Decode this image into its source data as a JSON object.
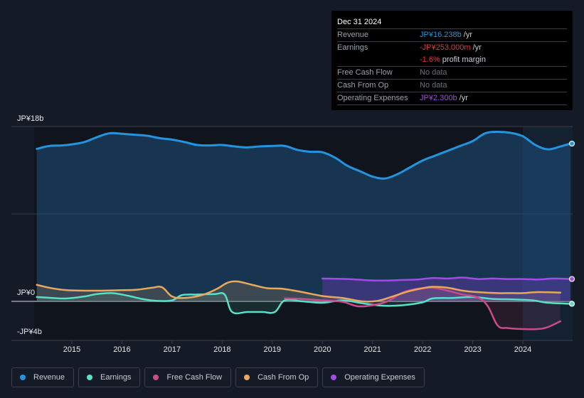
{
  "tooltip": {
    "date": "Dec 31 2024",
    "rows": [
      {
        "label": "Revenue",
        "value": "JP¥16.238b",
        "suffix": " /yr",
        "color": "#2394df"
      },
      {
        "label": "Earnings",
        "value": "-JP¥253.000m",
        "suffix": " /yr",
        "color": "#e5393c"
      },
      {
        "label": "",
        "value": "-1.6%",
        "suffix": " profit margin",
        "color": "#e5393c"
      },
      {
        "label": "Free Cash Flow",
        "value": "No data",
        "suffix": "",
        "color": "#6b7079"
      },
      {
        "label": "Cash From Op",
        "value": "No data",
        "suffix": "",
        "color": "#6b7079"
      },
      {
        "label": "Operating Expenses",
        "value": "JP¥2.300b",
        "suffix": " /yr",
        "color": "#a04de3"
      }
    ]
  },
  "legend": [
    {
      "label": "Revenue",
      "color": "#2394df"
    },
    {
      "label": "Earnings",
      "color": "#58dfc8"
    },
    {
      "label": "Free Cash Flow",
      "color": "#cc4b8c"
    },
    {
      "label": "Cash From Op",
      "color": "#e9a95c"
    },
    {
      "label": "Operating Expenses",
      "color": "#a04de3"
    }
  ],
  "chart_data": {
    "type": "line",
    "title": "",
    "xlabel": "",
    "ylabel": "",
    "y_unit": "JP¥ billions",
    "ylim": [
      -4,
      18
    ],
    "y_tick_labels": [
      {
        "value": 18,
        "label": "JP¥18b"
      },
      {
        "value": 0,
        "label": "JP¥0"
      },
      {
        "value": -4,
        "label": "-JP¥4b"
      }
    ],
    "x_range": [
      2014.3,
      2025.0
    ],
    "x_ticks": [
      "2015",
      "2016",
      "2017",
      "2018",
      "2019",
      "2020",
      "2021",
      "2022",
      "2023",
      "2024"
    ],
    "x_tick_values": [
      2015,
      2016,
      2017,
      2018,
      2019,
      2020,
      2021,
      2022,
      2023,
      2024
    ],
    "highlight_start": 2024.0,
    "grid": true,
    "legend_position": "bottom-left",
    "series": [
      {
        "name": "Revenue",
        "color": "#2394df",
        "x": [
          2014.3,
          2014.55,
          2014.8,
          2015.05,
          2015.25,
          2015.5,
          2015.75,
          2016.0,
          2016.25,
          2016.5,
          2016.75,
          2017.0,
          2017.25,
          2017.5,
          2017.75,
          2018.0,
          2018.25,
          2018.5,
          2018.75,
          2019.0,
          2019.25,
          2019.5,
          2019.75,
          2020.0,
          2020.25,
          2020.5,
          2020.75,
          2021.0,
          2021.25,
          2021.5,
          2021.75,
          2022.0,
          2022.25,
          2022.5,
          2022.75,
          2023.0,
          2023.25,
          2023.5,
          2023.75,
          2024.0,
          2024.25,
          2024.5,
          2024.75,
          2024.95
        ],
        "values": [
          15.7,
          16.0,
          16.05,
          16.2,
          16.4,
          16.9,
          17.3,
          17.25,
          17.15,
          17.05,
          16.8,
          16.65,
          16.4,
          16.1,
          16.05,
          16.1,
          15.95,
          15.85,
          15.95,
          16.0,
          16.0,
          15.6,
          15.4,
          15.35,
          14.8,
          13.95,
          13.4,
          12.85,
          12.65,
          13.1,
          13.8,
          14.5,
          15.0,
          15.5,
          16.0,
          16.5,
          17.3,
          17.45,
          17.35,
          17.0,
          16.1,
          15.65,
          15.95,
          16.24
        ]
      },
      {
        "name": "Earnings",
        "color": "#58dfc8",
        "x": [
          2014.3,
          2014.6,
          2014.9,
          2015.25,
          2015.5,
          2015.8,
          2016.1,
          2016.4,
          2016.7,
          2017.0,
          2017.2,
          2017.5,
          2017.85,
          2018.05,
          2018.2,
          2018.5,
          2018.8,
          2019.05,
          2019.25,
          2019.6,
          2020.0,
          2020.4,
          2020.8,
          2021.2,
          2021.6,
          2022.0,
          2022.2,
          2022.6,
          2023.0,
          2023.4,
          2023.8,
          2024.2,
          2024.5,
          2024.95
        ],
        "values": [
          0.45,
          0.35,
          0.3,
          0.5,
          0.75,
          0.85,
          0.6,
          0.25,
          0.05,
          0.1,
          0.65,
          0.7,
          0.75,
          0.7,
          -1.1,
          -1.1,
          -1.1,
          -1.1,
          0.1,
          0.0,
          -0.15,
          0.1,
          -0.2,
          -0.45,
          -0.4,
          -0.1,
          0.3,
          0.35,
          0.45,
          0.25,
          0.2,
          0.1,
          -0.15,
          -0.25
        ]
      },
      {
        "name": "Free Cash Flow",
        "color": "#cc4b8c",
        "x": [
          2019.25,
          2019.6,
          2020.0,
          2020.4,
          2020.7,
          2021.0,
          2021.3,
          2021.6,
          2021.9,
          2022.2,
          2022.5,
          2022.8,
          2023.1,
          2023.3,
          2023.5,
          2023.7,
          2024.0,
          2024.3,
          2024.5,
          2024.75
        ],
        "values": [
          0.3,
          0.25,
          0.1,
          -0.05,
          -0.5,
          -0.4,
          0.0,
          0.9,
          1.3,
          1.4,
          1.1,
          0.7,
          0.4,
          -0.5,
          -2.5,
          -2.75,
          -2.85,
          -2.85,
          -2.65,
          -2.05
        ]
      },
      {
        "name": "Cash From Op",
        "color": "#e9a95c",
        "x": [
          2014.3,
          2014.6,
          2014.9,
          2015.25,
          2015.6,
          2016.0,
          2016.3,
          2016.6,
          2016.8,
          2017.0,
          2017.25,
          2017.6,
          2017.9,
          2018.1,
          2018.3,
          2018.6,
          2018.9,
          2019.2,
          2019.6,
          2020.0,
          2020.4,
          2020.8,
          2021.1,
          2021.4,
          2021.7,
          2022.0,
          2022.2,
          2022.5,
          2022.8,
          2023.1,
          2023.5,
          2023.8,
          2024.0,
          2024.3,
          2024.75
        ],
        "values": [
          1.7,
          1.35,
          1.15,
          1.1,
          1.1,
          1.15,
          1.2,
          1.4,
          1.45,
          0.5,
          0.35,
          0.65,
          1.3,
          1.9,
          2.05,
          1.7,
          1.35,
          1.3,
          0.95,
          0.55,
          0.35,
          0.0,
          0.05,
          0.5,
          1.0,
          1.35,
          1.5,
          1.4,
          1.1,
          0.95,
          0.85,
          0.85,
          0.85,
          0.95,
          0.9
        ]
      },
      {
        "name": "Operating Expenses",
        "color": "#a04de3",
        "x": [
          2020.0,
          2020.5,
          2021.0,
          2021.3,
          2021.6,
          2021.9,
          2022.2,
          2022.5,
          2022.8,
          2023.1,
          2023.4,
          2023.7,
          2024.0,
          2024.3,
          2024.6,
          2024.95
        ],
        "values": [
          2.35,
          2.3,
          2.15,
          2.15,
          2.2,
          2.25,
          2.4,
          2.35,
          2.45,
          2.3,
          2.35,
          2.3,
          2.3,
          2.25,
          2.35,
          2.3
        ]
      }
    ]
  }
}
